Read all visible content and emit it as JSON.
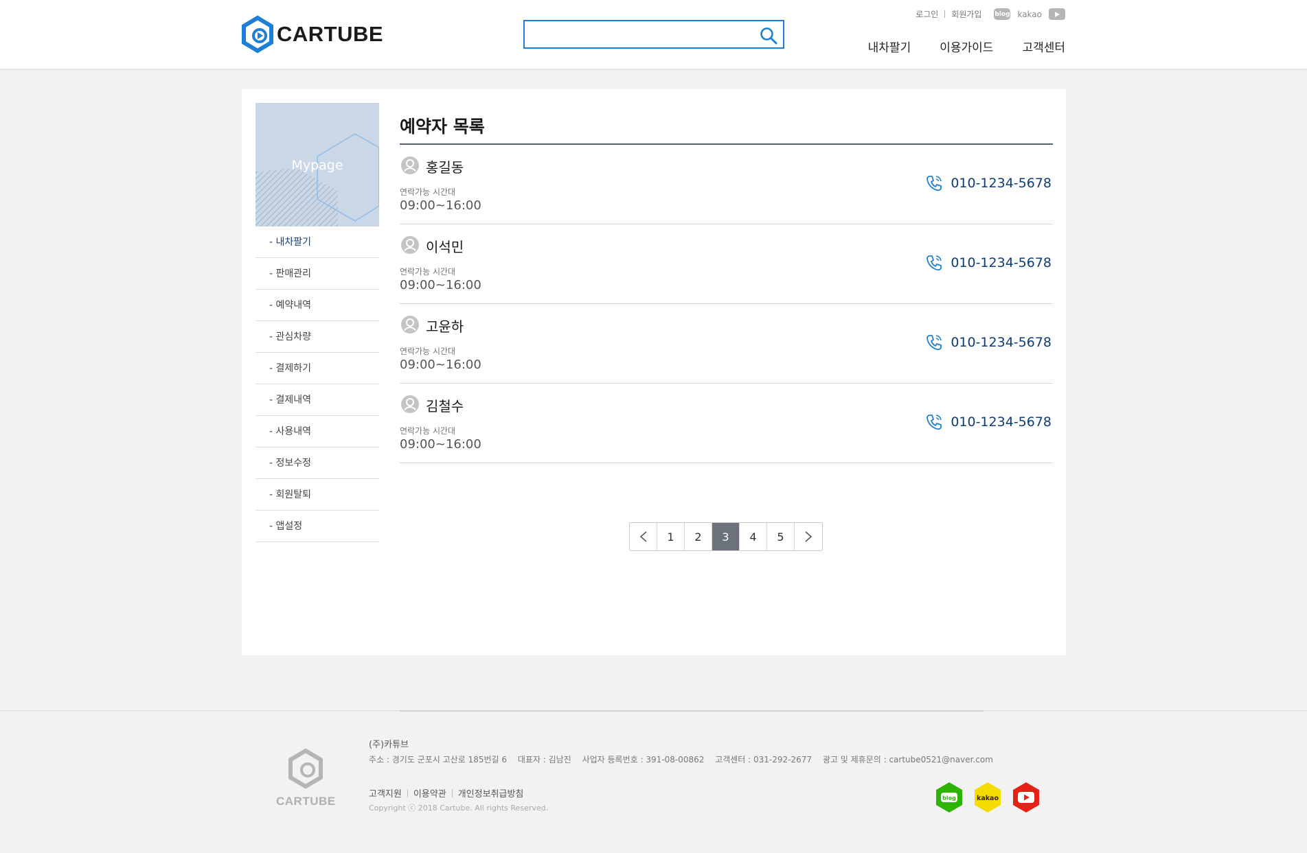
{
  "header": {
    "logo_text": "CARTUBE",
    "search": {
      "value": "",
      "placeholder": ""
    },
    "util": {
      "login": "로그인",
      "signup": "회원가입",
      "blog": "blog",
      "kakao": "kakao"
    },
    "nav": [
      "내차팔기",
      "이용가이드",
      "고객센터"
    ]
  },
  "sidebar": {
    "banner_title": "Mypage",
    "items": [
      {
        "label": "- 내차팔기",
        "active": true
      },
      {
        "label": "- 판매관리",
        "active": false
      },
      {
        "label": "- 예약내역",
        "active": false
      },
      {
        "label": "- 관심차량",
        "active": false
      },
      {
        "label": "- 결제하기",
        "active": false
      },
      {
        "label": "- 결제내역",
        "active": false
      },
      {
        "label": "- 사용내역",
        "active": false
      },
      {
        "label": "- 정보수정",
        "active": false
      },
      {
        "label": "- 회원탈퇴",
        "active": false
      },
      {
        "label": "-  앱설정",
        "active": false
      }
    ]
  },
  "main": {
    "title": "예약자 목록",
    "reservations": [
      {
        "name": "홍길동",
        "time_label": "연락가능 시간대",
        "time": "09:00~16:00",
        "phone": "010-1234-5678"
      },
      {
        "name": "이석민",
        "time_label": "연락가능 시간대",
        "time": "09:00~16:00",
        "phone": "010-1234-5678"
      },
      {
        "name": "고윤하",
        "time_label": "연락가능 시간대",
        "time": "09:00~16:00",
        "phone": "010-1234-5678"
      },
      {
        "name": "김철수",
        "time_label": "연락가능 시간대",
        "time": "09:00~16:00",
        "phone": "010-1234-5678"
      }
    ],
    "pagination": {
      "pages": [
        "1",
        "2",
        "3",
        "4",
        "5"
      ],
      "current": "3"
    }
  },
  "footer": {
    "logo_text": "CARTUBE",
    "company": "(주)카튜브",
    "info": [
      "주소 : 경기도 군포시 고산로 185번길 6",
      "대표자 : 김남진",
      "사업자 등록번호 : 391-08-00862",
      "고객센터 : 031-292-2677",
      "광고 및 제휴문의 : cartube0521@naver.com"
    ],
    "links": [
      "고객지원",
      "이용약관",
      "개인정보취급방침"
    ],
    "copyright": "Copyright ⓒ 2018 Cartube. All rights Reserved.",
    "social": {
      "blog": "blog",
      "kakao": "kakao"
    }
  },
  "colors": {
    "accent": "#1f7fd6",
    "phone_text": "#0d3c79",
    "pager_active": "#6b727c",
    "blog_green": "#2db400",
    "kakao_yellow": "#f5dc00",
    "youtube_red": "#e62117"
  }
}
